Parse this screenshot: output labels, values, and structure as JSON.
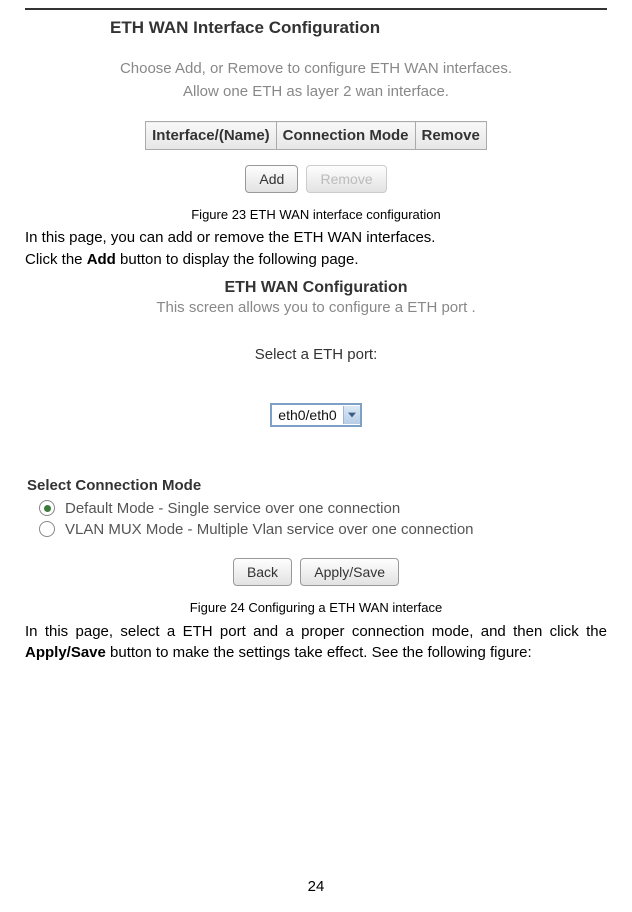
{
  "figure23": {
    "title": "ETH WAN Interface Configuration",
    "subtitle_line1": "Choose Add, or Remove to configure ETH WAN interfaces.",
    "subtitle_line2": "Allow one ETH as layer 2 wan interface.",
    "col1": "Interface/(Name)",
    "col2": "Connection Mode",
    "col3": "Remove",
    "add_btn": "Add",
    "remove_btn": "Remove",
    "caption": "Figure 23 ETH WAN interface configuration"
  },
  "para1": {
    "line1": "In this page, you can add or remove the ETH WAN interfaces.",
    "line2_a": "Click the ",
    "line2_b": "Add",
    "line2_c": " button to display the following page."
  },
  "figure24": {
    "title": "ETH WAN Configuration",
    "subtitle": "This screen allows you to configure a ETH port .",
    "prompt": "Select a ETH port:",
    "dropdown_value": "eth0/eth0",
    "section_header": "Select Connection Mode",
    "radio1": "Default Mode - Single service over one connection",
    "radio2": "VLAN MUX Mode - Multiple Vlan service over one connection",
    "back_btn": "Back",
    "apply_btn": "Apply/Save",
    "caption": "Figure 24 Configuring a ETH WAN interface"
  },
  "para2": {
    "a": "In this page, select a ETH port and a proper connection mode, and then click the ",
    "b": "Apply/Save",
    "c": " button to make the settings take effect. See the following figure:"
  },
  "pagenum": "24"
}
